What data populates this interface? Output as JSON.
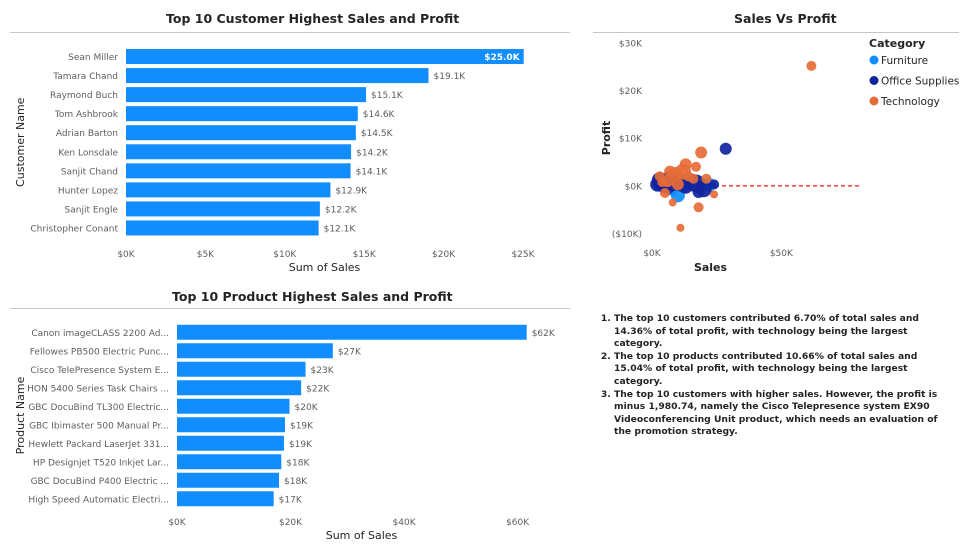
{
  "chart_data": [
    {
      "type": "bar",
      "orientation": "horizontal",
      "title": "Top 10 Customer Highest Sales and Profit",
      "xlabel": "Sum of Sales",
      "ylabel": "Customer Name",
      "categories": [
        "Sean Miller",
        "Tamara Chand",
        "Raymond Buch",
        "Tom Ashbrook",
        "Adrian Barton",
        "Ken Lonsdale",
        "Sanjit Chand",
        "Hunter Lopez",
        "Sanjit Engle",
        "Christopher Conant"
      ],
      "values": [
        25043,
        19052,
        15117,
        14596,
        14474,
        14175,
        14142,
        12873,
        12209,
        12129
      ],
      "data_labels": [
        "$25.0K",
        "$19.1K",
        "$15.1K",
        "$14.6K",
        "$14.5K",
        "$14.2K",
        "$14.1K",
        "$12.9K",
        "$12.2K",
        "$12.1K"
      ],
      "xticks": [
        "$0K",
        "$5K",
        "$10K",
        "$15K",
        "$20K",
        "$25K"
      ],
      "xlim": [
        0,
        25000
      ],
      "color": "#118DFF",
      "grid": false
    },
    {
      "type": "bar",
      "orientation": "horizontal",
      "title": "Top 10 Product Highest Sales and Profit",
      "xlabel": "Sum of Sales",
      "ylabel": "Product Name",
      "categories": [
        "Canon imageCLASS 2200 Ad...",
        "Fellowes PB500 Electric Punc...",
        "Cisco TelePresence System E...",
        "HON 5400 Series Task Chairs ...",
        "GBC DocuBind TL300 Electric...",
        "GBC Ibimaster 500 Manual Pr...",
        "Hewlett Packard LaserJet 331...",
        "HP Designjet T520 Inkjet Lar...",
        "GBC DocuBind P400 Electric ...",
        "High Speed Automatic Electri..."
      ],
      "values": [
        61600,
        27450,
        22640,
        21870,
        19820,
        19020,
        18840,
        18370,
        17970,
        17030
      ],
      "data_labels": [
        "$62K",
        "$27K",
        "$23K",
        "$22K",
        "$20K",
        "$19K",
        "$19K",
        "$18K",
        "$18K",
        "$17K"
      ],
      "xticks": [
        "$0K",
        "$20K",
        "$40K",
        "$60K"
      ],
      "xlim": [
        0,
        65000
      ],
      "color": "#118DFF",
      "grid": false
    },
    {
      "type": "scatter",
      "title": "Sales Vs Profit",
      "xlabel": "Sales",
      "ylabel": "Profit",
      "xticks": [
        "$0K",
        "$50K"
      ],
      "yticks": [
        "$30K",
        "$20K",
        "$10K",
        "$0K",
        "($10K)"
      ],
      "xlim": [
        0,
        80000
      ],
      "ylim": [
        -12000,
        30000
      ],
      "legend_title": "Category",
      "legend_position": "top-right",
      "reference_line": {
        "y": 0,
        "color": "#E8403A",
        "style": "dashed"
      },
      "series": [
        {
          "name": "Furniture",
          "color": "#118DFF",
          "points": [
            [
              3000,
              400,
              6
            ],
            [
              7000,
              -500,
              7
            ],
            [
              9000,
              1500,
              6
            ],
            [
              4500,
              900,
              8
            ],
            [
              12000,
              -300,
              6
            ],
            [
              15000,
              200,
              5
            ],
            [
              20000,
              300,
              5
            ],
            [
              2000,
              -200,
              5
            ],
            [
              10000,
              -2000,
              7
            ],
            [
              6000,
              1200,
              5
            ],
            [
              11000,
              700,
              6
            ],
            [
              18000,
              1000,
              5
            ],
            [
              22000,
              200,
              7
            ],
            [
              8000,
              -1000,
              5
            ],
            [
              14000,
              900,
              6
            ]
          ]
        },
        {
          "name": "Office Supplies",
          "color": "#12239E",
          "points": [
            [
              28500,
              7800,
              6
            ],
            [
              17000,
              500,
              9
            ],
            [
              5000,
              600,
              10
            ],
            [
              3000,
              1200,
              8
            ],
            [
              8000,
              800,
              9
            ],
            [
              13000,
              -200,
              7
            ],
            [
              20000,
              -700,
              8
            ],
            [
              6000,
              -300,
              7
            ],
            [
              10000,
              1500,
              6
            ],
            [
              2000,
              300,
              7
            ],
            [
              4000,
              -100,
              6
            ],
            [
              15000,
              1400,
              6
            ],
            [
              11000,
              300,
              7
            ],
            [
              7000,
              2000,
              6
            ],
            [
              18000,
              -1300,
              6
            ],
            [
              24000,
              300,
              5
            ]
          ]
        },
        {
          "name": "Technology",
          "color": "#E66C37",
          "points": [
            [
              61600,
              25200,
              5
            ],
            [
              19000,
              7000,
              6
            ],
            [
              13000,
              4500,
              6
            ],
            [
              18000,
              -4500,
              5
            ],
            [
              11000,
              -8800,
              4
            ],
            [
              12000,
              3000,
              8
            ],
            [
              9000,
              2500,
              7
            ],
            [
              6000,
              1000,
              6
            ],
            [
              7000,
              3000,
              6
            ],
            [
              14000,
              2000,
              5
            ],
            [
              5000,
              -1500,
              5
            ],
            [
              10000,
              300,
              6
            ],
            [
              16000,
              1500,
              5
            ],
            [
              3000,
              2000,
              5
            ],
            [
              8000,
              -3500,
              4
            ],
            [
              17000,
              4000,
              5
            ],
            [
              21000,
              1500,
              5
            ],
            [
              24000,
              -1800,
              4
            ],
            [
              4000,
              800,
              5
            ]
          ]
        }
      ]
    }
  ],
  "notes": [
    "The top 10 customers contributed 6.70% of total sales and 14.36% of total profit, with technology being the largest category.",
    "The top 10 products contributed 10.66% of total sales and 15.04% of total profit, with technology being the largest category.",
    "The top 10 customers with higher sales. However, the profit is minus 1,980.74, namely the Cisco Telepresence system EX90 Videoconferencing Unit product, which needs an evaluation of the promotion strategy."
  ]
}
